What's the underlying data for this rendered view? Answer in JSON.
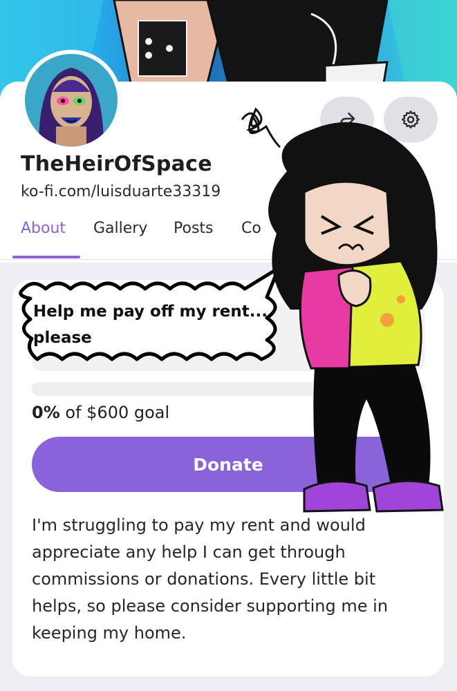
{
  "profile": {
    "name": "TheHeirOfSpace",
    "url": "ko-fi.com/luisduarte33319"
  },
  "actions": {
    "share_icon": "share-arrow-icon",
    "settings_icon": "gear-icon"
  },
  "tabs": [
    {
      "label": "About",
      "active": true
    },
    {
      "label": "Gallery",
      "active": false
    },
    {
      "label": "Posts",
      "active": false
    },
    {
      "label": "Co",
      "active": false
    }
  ],
  "goal": {
    "title_line1": "Help me pay off my rent...",
    "title_line2": "please",
    "progress_percent": 0,
    "progress_value": "0%",
    "progress_suffix": "of $600 goal",
    "donate_label": "Donate",
    "description": "I'm struggling to pay my rent and would appreciate any help I can get through commissions or donations. Every little bit helps, so please consider supporting me in keeping my home."
  },
  "colors": {
    "accent": "#8a62d9",
    "banner": "#2e9ee4"
  }
}
